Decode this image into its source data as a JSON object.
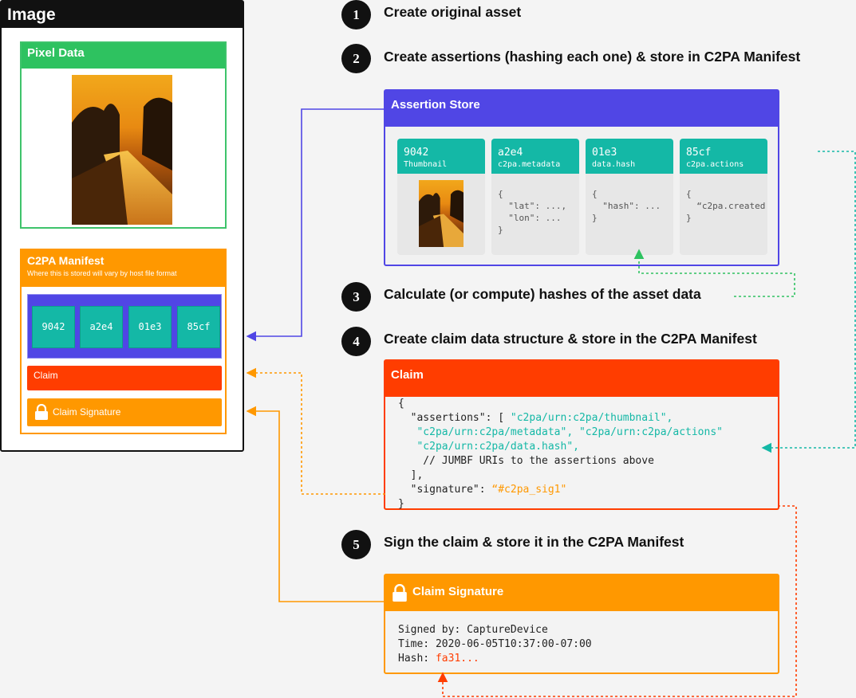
{
  "image_panel": {
    "title": "Image",
    "pixel_data_label": "Pixel Data",
    "manifest": {
      "title": "C2PA Manifest",
      "subtitle": "Where this is stored will vary by host file format",
      "assertion_ids": [
        "9042",
        "a2e4",
        "01e3",
        "85cf"
      ],
      "claim_label": "Claim",
      "signature_label": "Claim Signature"
    }
  },
  "steps": [
    {
      "num": "1",
      "text": "Create original asset"
    },
    {
      "num": "2",
      "text": "Create assertions (hashing each one) & store in C2PA Manifest"
    },
    {
      "num": "3",
      "text": "Calculate (or compute) hashes of the asset data"
    },
    {
      "num": "4",
      "text": "Create claim data structure & store in the C2PA Manifest"
    },
    {
      "num": "5",
      "text": "Sign the claim & store it in the C2PA Manifest"
    }
  ],
  "assertion_store": {
    "title": "Assertion Store",
    "cards": [
      {
        "id": "9042",
        "name": "Thumbnail",
        "body": ""
      },
      {
        "id": "a2e4",
        "name": "c2pa.metadata",
        "body": "{\n  \"lat\": ...,\n  \"lon\": ...\n}"
      },
      {
        "id": "01e3",
        "name": "data.hash",
        "body": "{\n  \"hash\": ...\n}"
      },
      {
        "id": "85cf",
        "name": "c2pa.actions",
        "body": "{\n  “c2pa.created\n}"
      }
    ]
  },
  "claim": {
    "title": "Claim",
    "open_brace": "{",
    "assertions_key": "  \"assertions\": [ ",
    "uri_thumbnail": "\"c2pa/urn:c2pa/thumbnail\",",
    "uri_metadata_line": "   \"c2pa/urn:c2pa/metadata\", \"c2pa/urn:c2pa/actions\"",
    "uri_datahash_line": "   \"c2pa/urn:c2pa/data.hash\",",
    "comment": "    // JUMBF URIs to the assertions above",
    "close_bracket": "  ],",
    "signature_key": "  \"signature\": ",
    "signature_value": "“#c2pa_sig1\"",
    "close_brace": "}"
  },
  "claim_signature": {
    "title": "Claim Signature",
    "signed_by": "Signed by: CaptureDevice",
    "time": "Time: 2020-06-05T10:37:00-07:00",
    "hash_label": "Hash: ",
    "hash_value": "fa31..."
  },
  "colors": {
    "assertion_purple": "#5046e5",
    "teal": "#14b8a6",
    "claim_red": "#ff3d00",
    "signature_orange": "#ff9800",
    "pixel_green": "#2ec260"
  }
}
